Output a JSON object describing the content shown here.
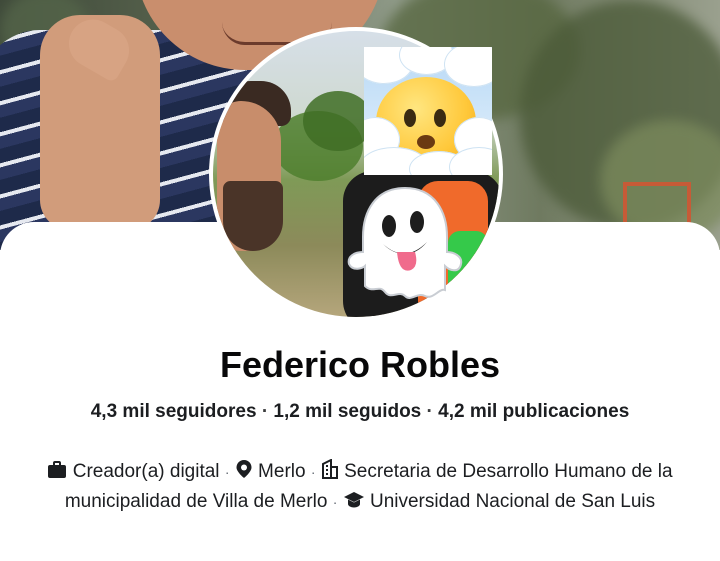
{
  "profile": {
    "name": "Federico Robles",
    "stats": {
      "followers": "4,3 mil seguidores",
      "following": "1,2 mil seguidos",
      "posts": "4,2 mil publicaciones",
      "separator": "·"
    },
    "details": [
      {
        "icon": "briefcase-icon",
        "text": "Creador(a) digital"
      },
      {
        "icon": "location-pin-icon",
        "text": "Merlo"
      },
      {
        "icon": "office-building-icon",
        "text": "Secretaria de Desarrollo Humano de la municipalidad de Villa de Merlo"
      },
      {
        "icon": "graduation-cap-icon",
        "text": "Universidad Nacional de San Luis"
      }
    ],
    "detail_separator": "·"
  },
  "sticker_emojis": [
    "face-in-clouds-emoji",
    "ghost-emoji"
  ],
  "colors": {
    "text_primary": "#080809",
    "text_secondary": "#1c1e21",
    "background": "#ffffff"
  }
}
